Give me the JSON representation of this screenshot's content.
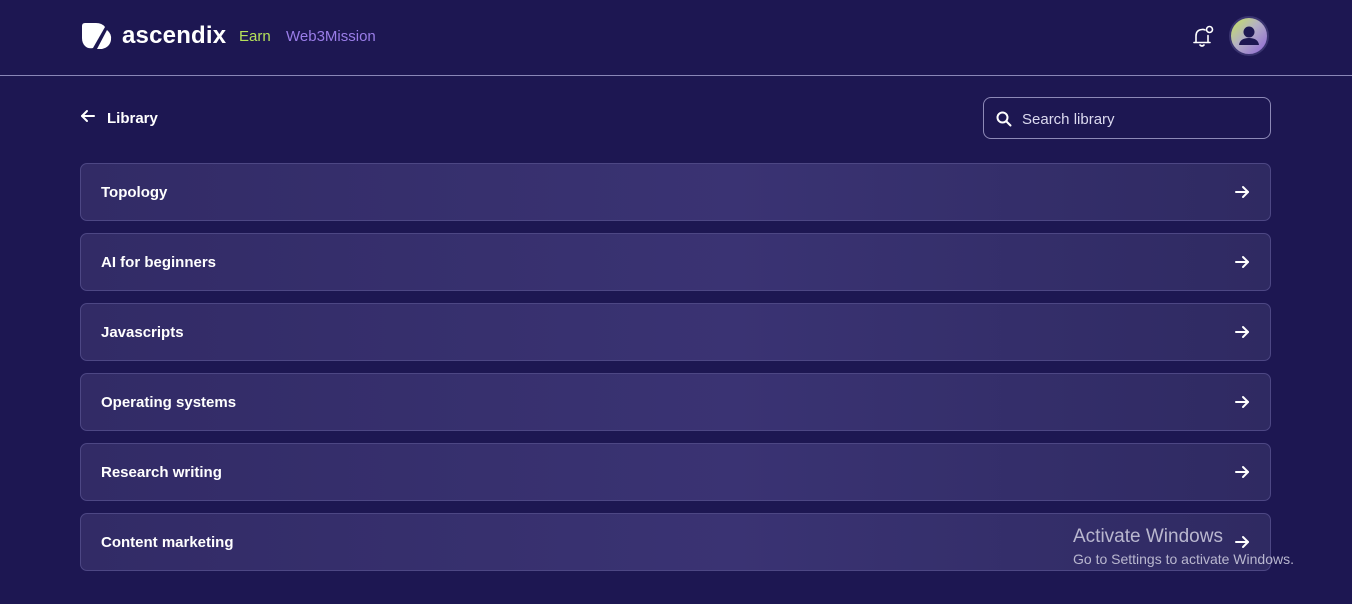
{
  "header": {
    "brand": "ascendix",
    "nav": {
      "earn": "Earn",
      "web3mission": "Web3Mission"
    },
    "icons": {
      "logo": "ascendix-logo-icon",
      "notifications": "bell-icon",
      "avatar": "user-avatar-icon"
    }
  },
  "page": {
    "back_label": "Library",
    "search": {
      "placeholder": "Search library",
      "value": ""
    }
  },
  "courses": [
    {
      "title": "Topology"
    },
    {
      "title": "AI for beginners"
    },
    {
      "title": "Javascripts"
    },
    {
      "title": "Operating systems"
    },
    {
      "title": "Research writing"
    },
    {
      "title": "Content marketing"
    }
  ],
  "watermark": {
    "line1": "Activate Windows",
    "line2": "Go to Settings to activate Windows."
  },
  "colors": {
    "background": "#1d1752",
    "earn": "#b5e05a",
    "web3mission": "#9a7de8",
    "card": "#352e6b"
  }
}
